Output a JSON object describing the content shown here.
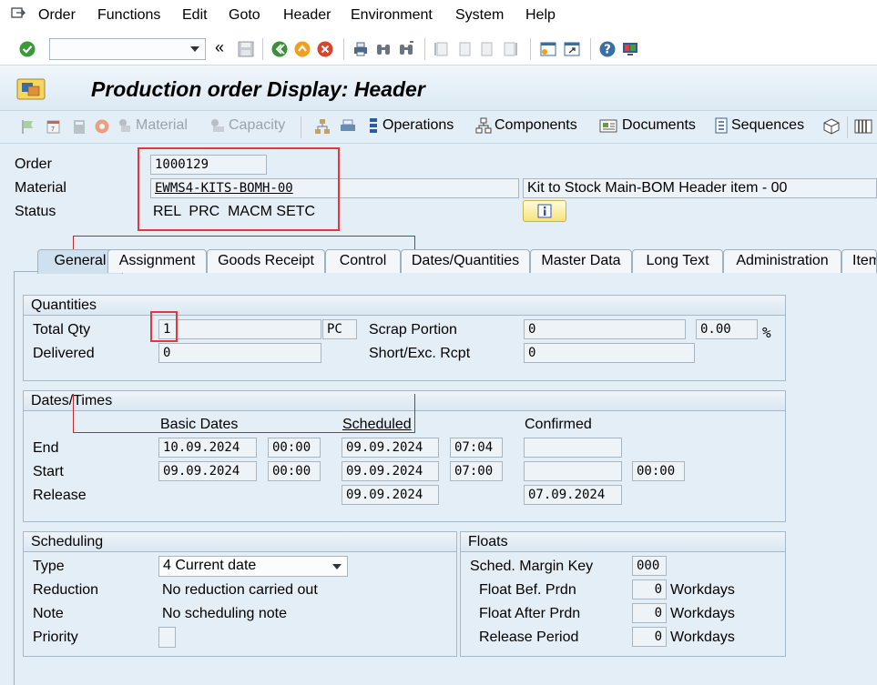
{
  "menu": {
    "items": [
      "Order",
      "Functions",
      "Edit",
      "Goto",
      "Header",
      "Environment",
      "System",
      "Help"
    ]
  },
  "title": "Production order Display: Header",
  "app_toolbar": {
    "material": "Material",
    "capacity": "Capacity",
    "operations": "Operations",
    "components": "Components",
    "documents": "Documents",
    "sequences": "Sequences"
  },
  "header": {
    "order_label": "Order",
    "order_value": "1000129",
    "material_label": "Material",
    "material_value": "EWMS4-KITS-BOMH-00",
    "material_desc": "Kit to Stock Main-BOM Header item - 00",
    "status_label": "Status",
    "status_value": "REL  PRC  MACM SETC"
  },
  "tabs": [
    "General",
    "Assignment",
    "Goods Receipt",
    "Control",
    "Dates/Quantities",
    "Master Data",
    "Long Text",
    "Administration",
    "Item"
  ],
  "quantities": {
    "title": "Quantities",
    "total_qty_label": "Total Qty",
    "total_qty": "1",
    "unit": "PC",
    "scrap_portion_label": "Scrap Portion",
    "scrap_portion": "0",
    "scrap_percent": "0.00",
    "percent_sign": "%",
    "delivered_label": "Delivered",
    "delivered": "0",
    "short_exc_label": "Short/Exc. Rcpt",
    "short_exc": "0"
  },
  "dates": {
    "title": "Dates/Times",
    "col_basic": "Basic Dates",
    "col_scheduled": "Scheduled",
    "col_confirmed": "Confirmed",
    "end_label": "End",
    "start_label": "Start",
    "release_label": "Release",
    "end_basic_date": "10.09.2024",
    "end_basic_time": "00:00",
    "end_sched_date": "09.09.2024",
    "end_sched_time": "07:04",
    "start_basic_date": "09.09.2024",
    "start_basic_time": "00:00",
    "start_sched_date": "09.09.2024",
    "start_sched_time": "07:00",
    "start_conf_time": "00:00",
    "release_sched_date": "09.09.2024",
    "release_conf_date": "07.09.2024"
  },
  "scheduling": {
    "title": "Scheduling",
    "type_label": "Type",
    "type_value": "4 Current date",
    "reduction_label": "Reduction",
    "reduction_value": "No reduction carried out",
    "note_label": "Note",
    "note_value": "No scheduling note",
    "priority_label": "Priority"
  },
  "floats": {
    "title": "Floats",
    "margin_key_label": "Sched. Margin Key",
    "margin_key": "000",
    "float_bef_label": "Float Bef. Prdn",
    "float_bef": "0",
    "float_after_label": "Float After Prdn",
    "float_after": "0",
    "release_period_label": "Release Period",
    "release_period": "0",
    "unit": "Workdays"
  },
  "colors": {
    "highlight": "#e0383b",
    "accent": "#cfe0ee"
  }
}
